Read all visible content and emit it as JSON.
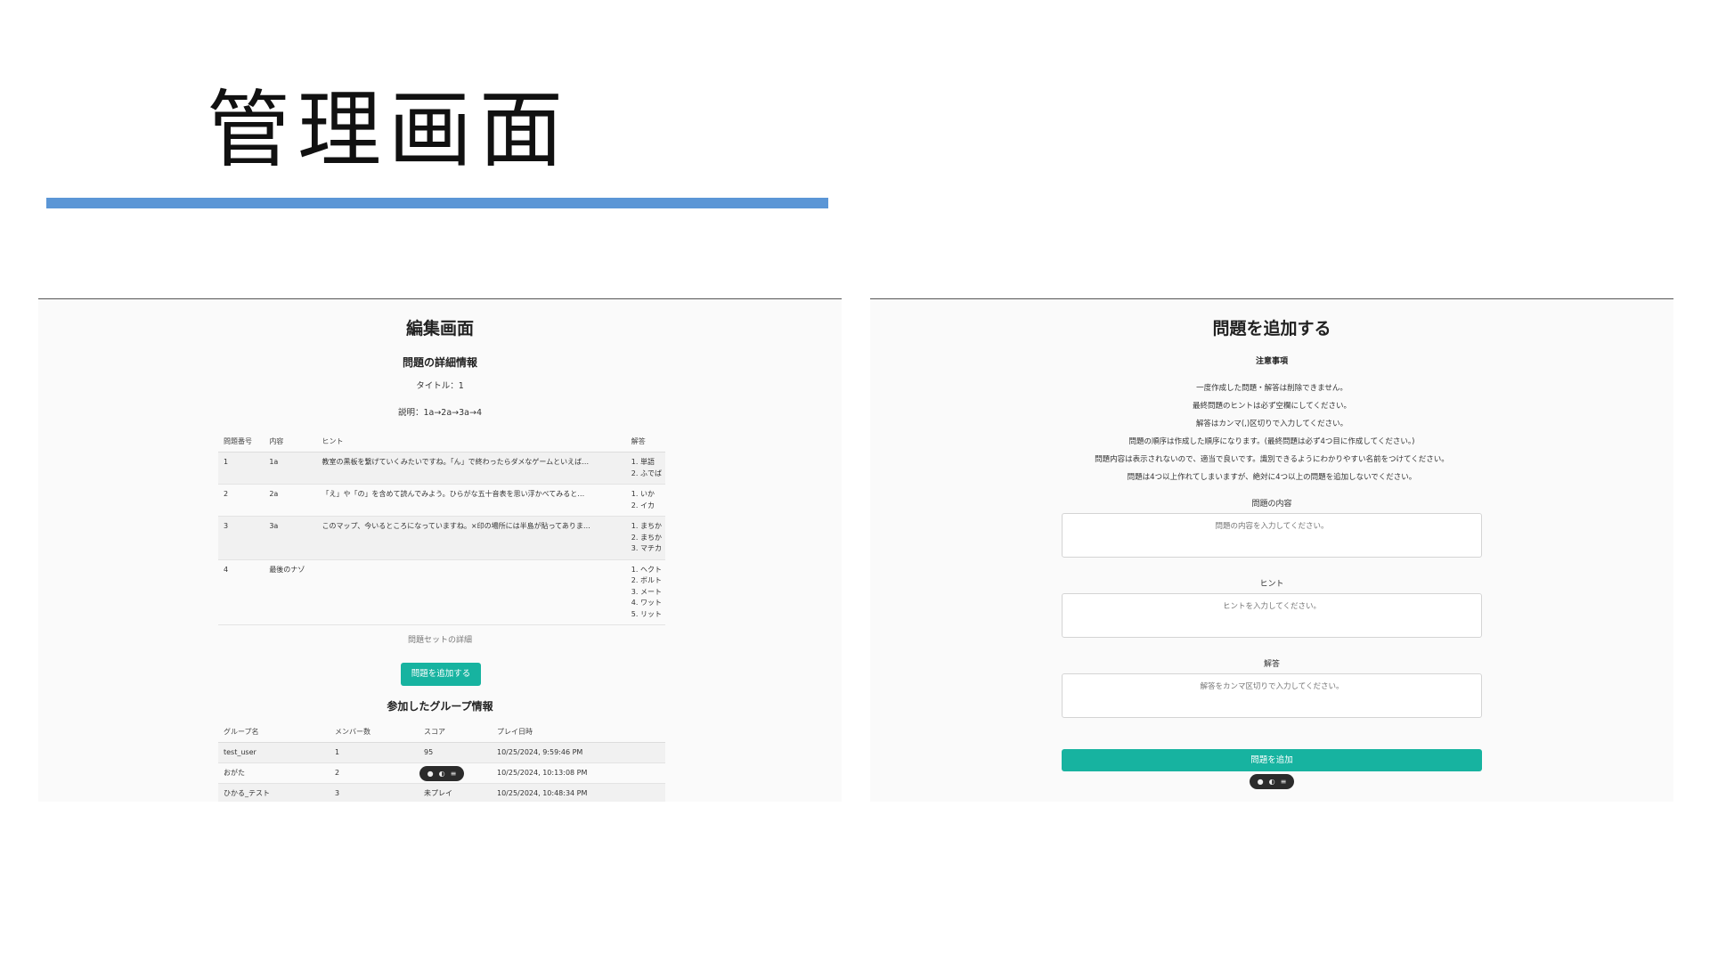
{
  "slide": {
    "title": "管理画面",
    "accent_color": "#5b96d6"
  },
  "left_screen": {
    "title": "編集画面",
    "detail_heading": "問題の詳細情報",
    "set_title": "タイトル：1",
    "set_description": "説明：1a→2a→3a→4",
    "problems_table": {
      "headers": [
        "問題番号",
        "内容",
        "ヒント",
        "解答"
      ],
      "rows": [
        {
          "number": "1",
          "content": "1a",
          "hint": "教室の黒板を繋げていくみたいですね。「ん」で終わったらダメなゲームといえば…",
          "answers": [
            "1. 単語",
            "2. ふでば"
          ]
        },
        {
          "number": "2",
          "content": "2a",
          "hint": "「え」や「の」を含めて読んでみよう。ひらがな五十音表を思い浮かべてみると…",
          "answers": [
            "1. いか",
            "2. イカ"
          ]
        },
        {
          "number": "3",
          "content": "3a",
          "hint": "このマップ、今いるところになっていますね。×印の場所には半島が貼ってありま…",
          "answers": [
            "1. まちか",
            "2. まちか",
            "3. マチカ"
          ]
        },
        {
          "number": "4",
          "content": "最後のナゾ",
          "hint": "",
          "answers": [
            "1. ヘクト",
            "2. ボルト",
            "3. メート",
            "4. ワット",
            "5. リット"
          ]
        }
      ]
    },
    "set_detail_link": "問題セットの詳細",
    "add_problem_button": "問題を追加する",
    "group_heading": "参加したグループ情報",
    "group_table": {
      "headers": [
        "グループ名",
        "メンバー数",
        "スコア",
        "プレイ日時"
      ],
      "rows": [
        {
          "name": "test_user",
          "members": "1",
          "score": "95",
          "played_at": "10/25/2024, 9:59:46 PM"
        },
        {
          "name": "おがた",
          "members": "2",
          "score": "",
          "played_at": "10/25/2024, 10:13:08 PM"
        },
        {
          "name": "ひかる_テスト",
          "members": "3",
          "score": "未プレイ",
          "played_at": "10/25/2024, 10:48:34 PM"
        }
      ]
    },
    "toolbar_icons": [
      "chat-icon",
      "link-icon",
      "menu-icon"
    ]
  },
  "right_screen": {
    "title": "問題を追加する",
    "notes_heading": "注意事項",
    "notes": [
      "一度作成した問題・解答は削除できません。",
      "最終問題のヒントは必ず空欄にしてください。",
      "解答はカンマ(,)区切りで入力してください。",
      "問題の順序は作成した順序になります。(最終問題は必ず4つ目に作成してください。)",
      "問題内容は表示されないので、適当で良いです。識別できるようにわかりやすい名前をつけてください。",
      "問題は4つ以上作れてしまいますが、絶対に4つ以上の問題を追加しないでください。"
    ],
    "fields": {
      "content": {
        "label": "問題の内容",
        "placeholder": "問題の内容を入力してください。"
      },
      "hint": {
        "label": "ヒント",
        "placeholder": "ヒントを入力してください。"
      },
      "answer": {
        "label": "解答",
        "placeholder": "解答をカンマ区切りで入力してください。"
      }
    },
    "submit_button": "問題を追加",
    "accent_color": "#17b3a0"
  }
}
